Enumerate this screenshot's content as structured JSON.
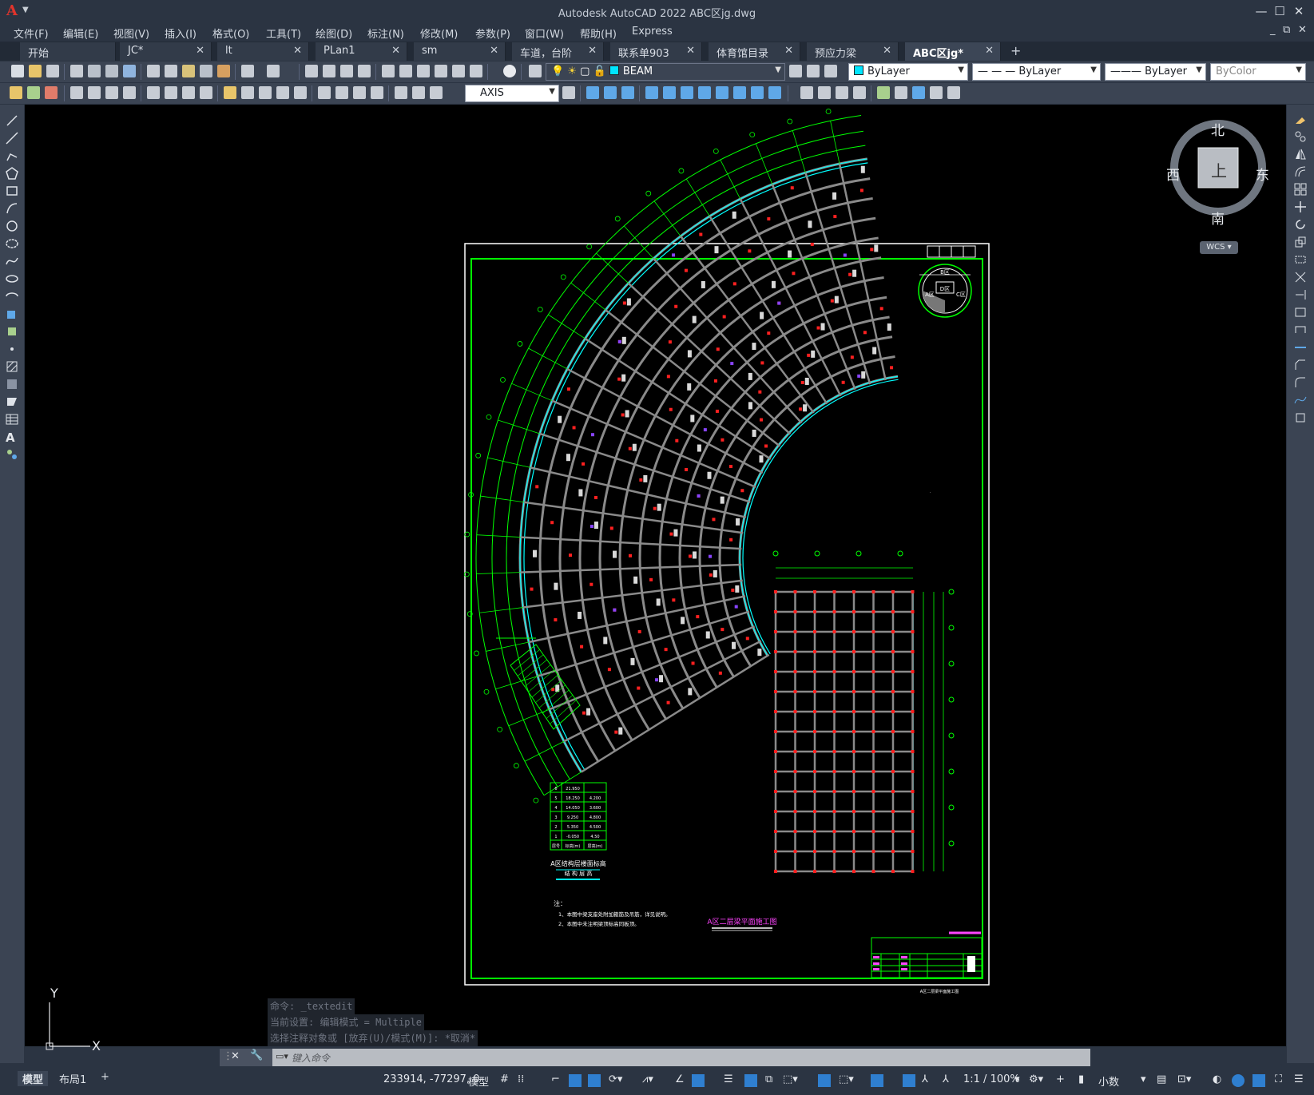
{
  "app": {
    "logo_letter": "A",
    "title": "Autodesk AutoCAD 2022    ABC区jg.dwg"
  },
  "window_controls": {
    "minimize": "—",
    "maximize": "☐",
    "close": "✕"
  },
  "doc_controls": {
    "minimize": "_",
    "restore": "⧉",
    "close": "✕"
  },
  "menu": [
    "文件(F)",
    "编辑(E)",
    "视图(V)",
    "插入(I)",
    "格式(O)",
    "工具(T)",
    "绘图(D)",
    "标注(N)",
    "修改(M)",
    "参数(P)",
    "窗口(W)",
    "帮助(H)",
    "Express"
  ],
  "tabs": [
    {
      "label": "开始",
      "closable": false
    },
    {
      "label": "JC*",
      "closable": true
    },
    {
      "label": "lt",
      "closable": true
    },
    {
      "label": "PLan1",
      "closable": true
    },
    {
      "label": "sm",
      "closable": true
    },
    {
      "label": "车道，台阶",
      "closable": true
    },
    {
      "label": "联系单903",
      "closable": true
    },
    {
      "label": "体育馆目录",
      "closable": true
    },
    {
      "label": "预应力梁",
      "closable": true
    },
    {
      "label": "ABC区jg*",
      "closable": true,
      "active": true
    }
  ],
  "tab_add": "+",
  "tab_close": "✕",
  "layer_combo": {
    "value": "BEAM",
    "color": "#00e5ff"
  },
  "color_combo": {
    "value": "ByLayer",
    "color": "#00e5ff"
  },
  "linetype_combo": {
    "value": "— — — ByLayer"
  },
  "lineweight_combo": {
    "value": "——— ByLayer"
  },
  "plotstyle_combo": {
    "value": "ByColor"
  },
  "dimstyle_combo": {
    "value": "AXIS"
  },
  "viewcube": {
    "north": "北",
    "south": "南",
    "east": "东",
    "west": "西",
    "top": "上",
    "wcs": "WCS"
  },
  "drawing": {
    "title_block_main": "A区二层梁平面施工图",
    "table_title": "A区结构层楼面标高",
    "table_subtitle": "结 构 层 高",
    "notes_heading": "注：",
    "notes": [
      "1、本图中梁支座处附加箍筋及吊筋，详见说明。",
      "2、本图中未注明梁顶标高同板顶。"
    ],
    "bottom_caption": "A区二层梁平面施工图",
    "table_rows": [
      [
        "6",
        "21.950",
        ""
      ],
      [
        "5",
        "18.250",
        "4.200"
      ],
      [
        "4",
        "14.050",
        "3.600"
      ],
      [
        "3",
        "9.250",
        "4.800"
      ],
      [
        "2",
        "5.350",
        "4.500"
      ],
      [
        "1",
        "-0.050",
        "4.50"
      ],
      [
        "层号",
        "标高(m)",
        "层高(m)"
      ]
    ],
    "index_labels": {
      "a": "B区",
      "b": "D区",
      "c": "A区",
      "d": "C区"
    }
  },
  "ucs": {
    "x": "X",
    "y": "Y"
  },
  "command": {
    "history": [
      "命令: _textedit",
      "当前设置: 编辑模式 = Multiple",
      "选择注释对象或 [放弃(U)/模式(M)]: *取消*"
    ],
    "placeholder": "键入命令"
  },
  "layouts": [
    {
      "label": "模型",
      "active": true
    },
    {
      "label": "布局1",
      "active": false
    }
  ],
  "layout_add": "+",
  "status": {
    "coords": "233914, -77297, 0",
    "model": "模型",
    "scale": "1:1 / 100%",
    "units": "小数"
  }
}
